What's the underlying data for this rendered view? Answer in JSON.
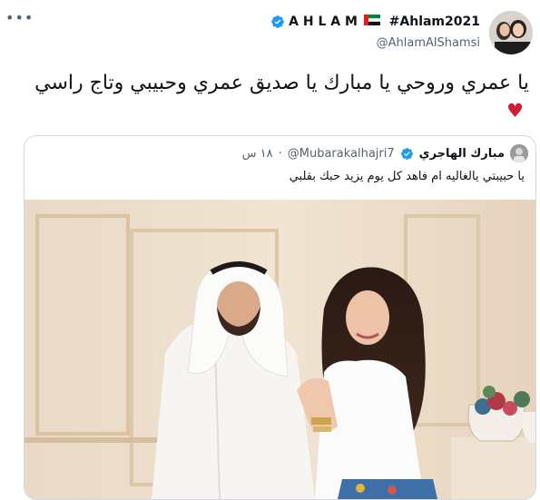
{
  "tweet": {
    "more_icon": "more-horizontal-icon",
    "name_text": "A H L A M",
    "hashtag": "#Ahlam2021",
    "handle": "@AhlamAlShamsi",
    "text": "يا عمري وروحي يا مبارك يا صديق عمري وحبيبي وتاج راسي",
    "emoji": "♥",
    "icons": {
      "verified": "verified-badge-icon",
      "flag": "uae-flag-icon",
      "avatar": "profile-avatar"
    },
    "colors": {
      "verified": "#1d9bf0",
      "heart": "#cc1f36",
      "secondary_text": "#536471",
      "border": "#cfd9de"
    }
  },
  "quote": {
    "name": "مبارك الهاجري",
    "handle": "@Mubarakalhajri7",
    "separator": "·",
    "time": "١٨ س",
    "text": "يا حبيبتي يالغاليه ام فاهد كل يوم يزيد حبك بقلبي",
    "image_alt": "couple-photo"
  }
}
